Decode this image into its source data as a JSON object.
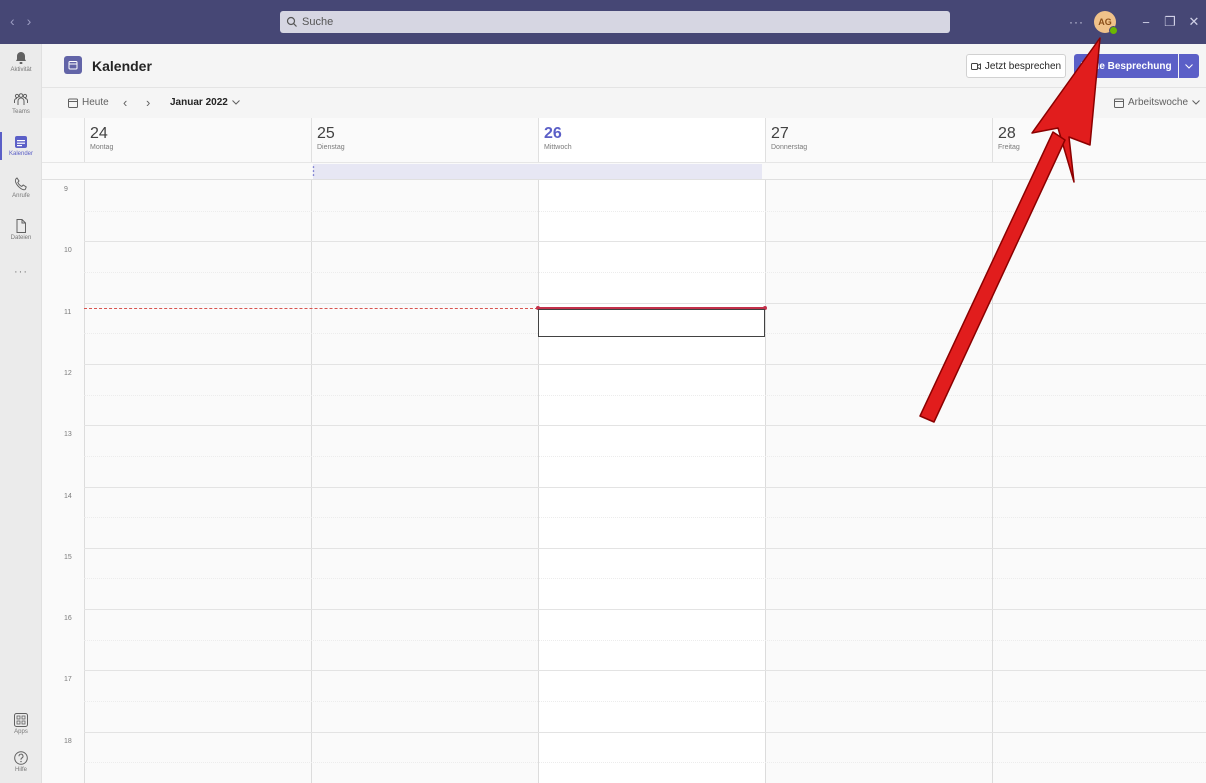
{
  "titlebar": {
    "search_placeholder": "Suche",
    "more": "···",
    "avatar_initials": "AG",
    "minimize": "−",
    "restore": "❐",
    "close": "✕"
  },
  "rail": {
    "items": [
      {
        "label": "Aktivität"
      },
      {
        "label": "Teams"
      },
      {
        "label": "Kalender"
      },
      {
        "label": "Anrufe"
      },
      {
        "label": "Dateien"
      }
    ],
    "more": "···",
    "apps": "Apps",
    "help": "Hilfe"
  },
  "header": {
    "title": "Kalender",
    "meet_now": "Jetzt besprechen",
    "new_meeting": "Neue Besprechung"
  },
  "toolbar": {
    "today": "Heute",
    "month": "Januar 2022",
    "view": "Arbeitswoche"
  },
  "days": [
    {
      "num": "24",
      "name": "Montag"
    },
    {
      "num": "25",
      "name": "Dienstag"
    },
    {
      "num": "26",
      "name": "Mittwoch"
    },
    {
      "num": "27",
      "name": "Donnerstag"
    },
    {
      "num": "28",
      "name": "Freitag"
    }
  ],
  "hours": [
    "9",
    "10",
    "11",
    "12",
    "13",
    "14",
    "15",
    "16",
    "17",
    "18"
  ],
  "colors": {
    "titlebar": "#464775",
    "accent": "#5b5fc7",
    "now_line": "#c4314b",
    "arrow": "#e11d1d"
  }
}
